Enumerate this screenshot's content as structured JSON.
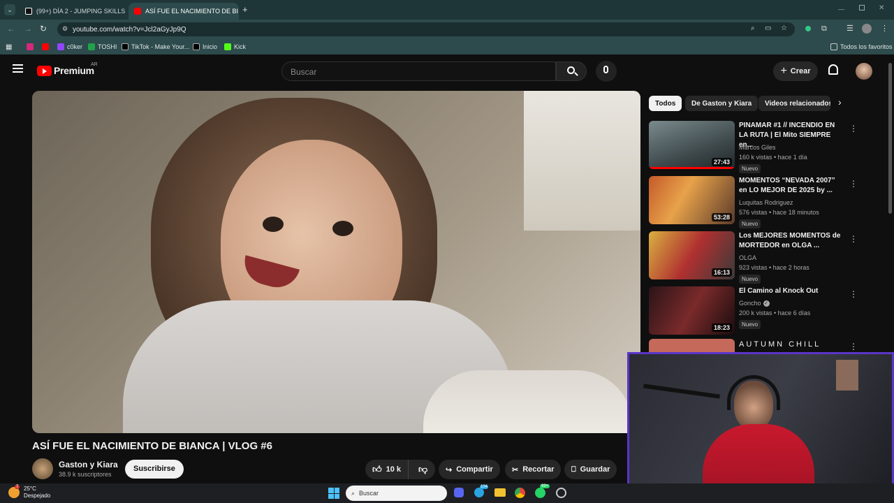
{
  "browser": {
    "tabs": [
      {
        "label": "(99+) DÍA 2 - JUMPING SKILLS #",
        "close": "✕"
      },
      {
        "label": "ASÍ FUE EL NACIMIENTO DE BI",
        "close": "✕"
      }
    ],
    "new_tab": "+",
    "url": "youtube.com/watch?v=Jcl2aGyJp9Q",
    "bookmarks": [
      "c0ker",
      "TOSHI",
      "TikTok - Make Your...",
      "Inicio",
      "Kick"
    ],
    "favorites_label": "Todos los favoritos"
  },
  "youtube": {
    "logo_text": "Premium",
    "logo_region": "AR",
    "search_placeholder": "Buscar",
    "create_label": "Crear",
    "video_title": "ASÍ FUE EL NACIMIENTO DE BIANCA | VLOG #6",
    "channel_name": "Gaston y Kiara",
    "subscribers": "38.9 k suscriptores",
    "subscribe_label": "Suscribirse",
    "likes": "10 k",
    "share_label": "Compartir",
    "clip_label": "Recortar",
    "save_label": "Guardar",
    "chips": [
      "Todos",
      "De Gaston y Kiara",
      "Videos relacionados"
    ],
    "related": [
      {
        "title": "PINAMAR #1 // INCENDIO EN LA RUTA | El Mito SIEMPRE en...",
        "channel": "Marcos Giles",
        "meta": "160 k vistas • hace 1 día",
        "badge": "Nuevo",
        "duration": "27:43"
      },
      {
        "title": "MOMENTOS “NEVADA 2007” en LO MEJOR DE 2025 by ...",
        "channel": "Luquitas Rodriguez",
        "meta": "576 vistas • hace 18 minutos",
        "badge": "Nuevo",
        "duration": "53:28"
      },
      {
        "title": "Los MEJORES MOMENTOS de MORTEDOR en OLGA ...",
        "channel": "OLGA",
        "meta": "923 vistas • hace 2 horas",
        "badge": "Nuevo",
        "duration": "16:13"
      },
      {
        "title": "El Camino al Knock Out",
        "channel": "Goncho",
        "meta": "200 k vistas • hace 6 días",
        "badge": "Nuevo",
        "duration": "18:23"
      },
      {
        "title": "AUTUMN CHILL"
      }
    ]
  },
  "taskbar": {
    "temp": "25°C",
    "weather": "Despejado",
    "search": "Buscar",
    "badge_telegram": "104",
    "badge_whatsapp": "99+",
    "weather_badge": "7"
  }
}
